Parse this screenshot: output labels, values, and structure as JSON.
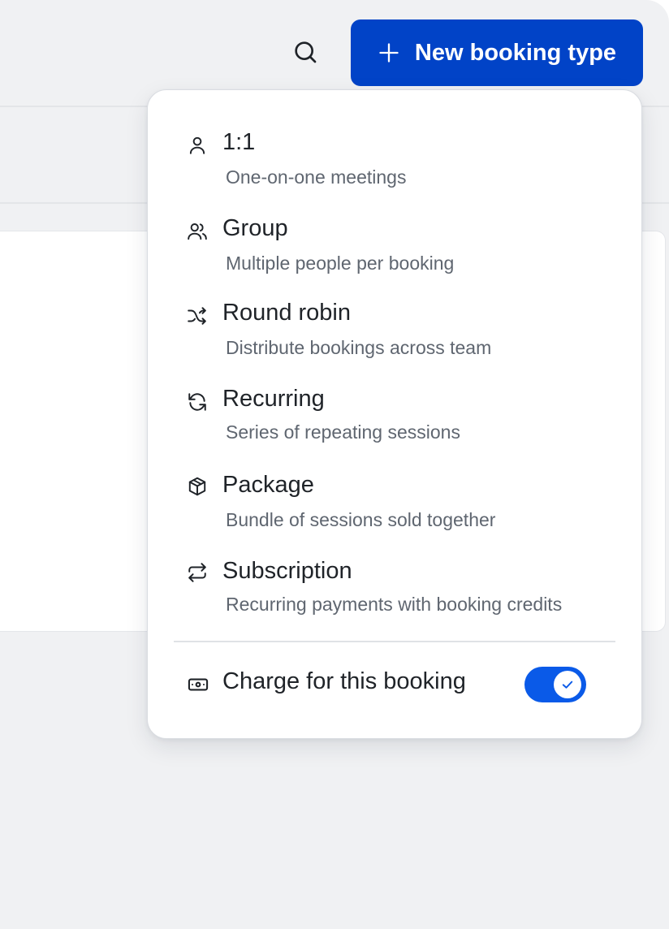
{
  "header": {
    "search_icon": "search-icon",
    "new_button": {
      "label": "New booking type",
      "icon": "plus-icon",
      "color": "#0143c7"
    }
  },
  "menu": {
    "items": [
      {
        "icon": "user-icon",
        "title": "1:1",
        "description": "One-on-one meetings"
      },
      {
        "icon": "users-icon",
        "title": "Group",
        "description": "Multiple people per booking"
      },
      {
        "icon": "shuffle-icon",
        "title": "Round robin",
        "description": "Distribute bookings across team"
      },
      {
        "icon": "refresh-icon",
        "title": "Recurring",
        "description": "Series of repeating sessions"
      },
      {
        "icon": "package-icon",
        "title": "Package",
        "description": "Bundle of sessions sold together"
      },
      {
        "icon": "repeat-icon",
        "title": "Subscription",
        "description": "Recurring payments with booking credits"
      }
    ],
    "charge": {
      "icon": "banknote-icon",
      "label": "Charge for this booking",
      "enabled": true,
      "toggle_color": "#0a5ae8"
    }
  }
}
